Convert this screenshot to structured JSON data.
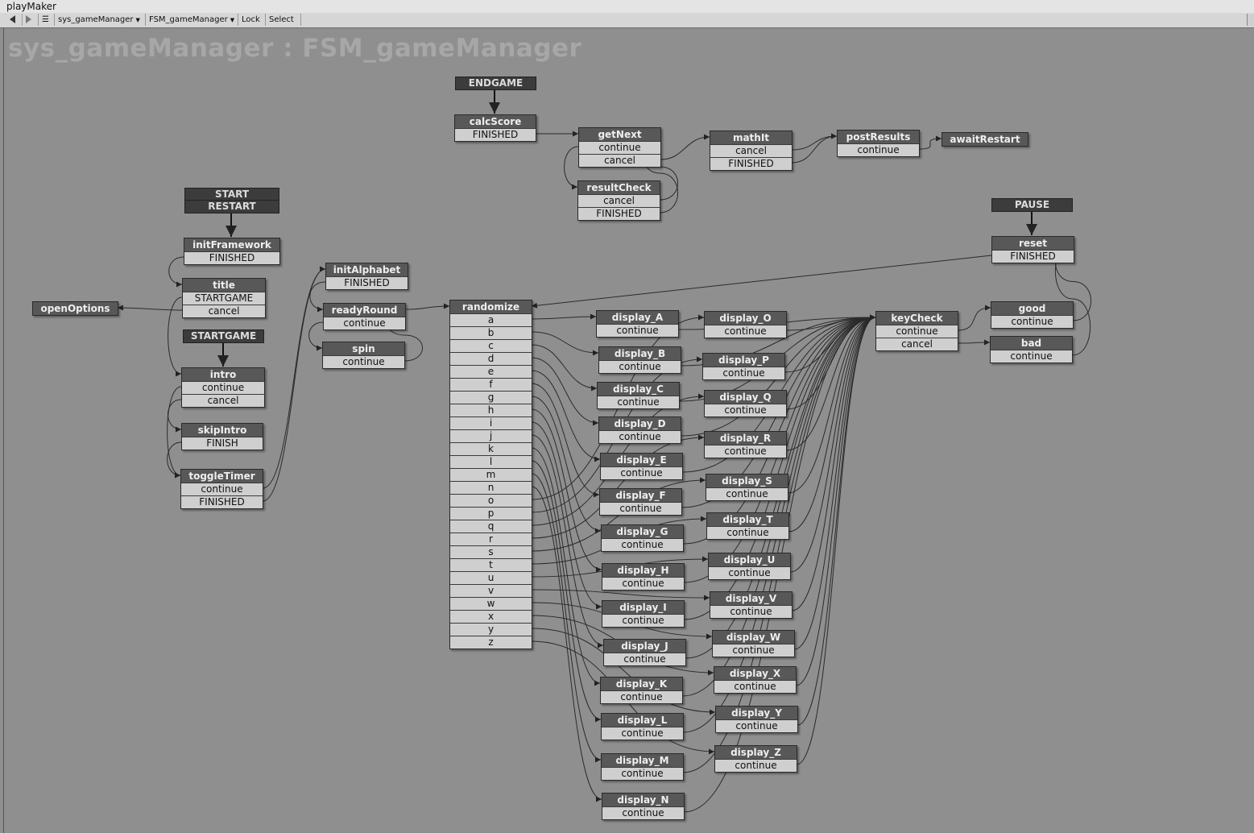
{
  "window": {
    "title": "playMaker"
  },
  "toolbar": {
    "back_icon": "triangle-left",
    "forward_icon": "triangle-right",
    "menu_icon": "hamburger",
    "gameobject": "sys_gameManager",
    "fsm": "FSM_gameManager",
    "lock_label": "Lock",
    "select_label": "Select"
  },
  "graph": {
    "title": "sys_gameManager : FSM_gameManager",
    "global_events": [
      {
        "id": "ev_endgame",
        "lines": [
          "ENDGAME"
        ]
      },
      {
        "id": "ev_start",
        "lines": [
          "START",
          "RESTART"
        ]
      },
      {
        "id": "ev_startgame",
        "lines": [
          "STARTGAME"
        ]
      },
      {
        "id": "ev_pause",
        "lines": [
          "PAUSE"
        ]
      }
    ],
    "states": [
      {
        "id": "calcScore",
        "name": "calcScore",
        "transitions": [
          "FINISHED"
        ]
      },
      {
        "id": "getNext",
        "name": "getNext",
        "transitions": [
          "continue",
          "cancel"
        ]
      },
      {
        "id": "resultCheck",
        "name": "resultCheck",
        "transitions": [
          "cancel",
          "FINISHED"
        ]
      },
      {
        "id": "mathIt",
        "name": "mathIt",
        "transitions": [
          "cancel",
          "FINISHED"
        ]
      },
      {
        "id": "postResults",
        "name": "postResults",
        "transitions": [
          "continue"
        ]
      },
      {
        "id": "awaitRestart",
        "name": "awaitRestart",
        "transitions": []
      },
      {
        "id": "initFramework",
        "name": "initFramework",
        "transitions": [
          "FINISHED"
        ]
      },
      {
        "id": "title",
        "name": "title",
        "transitions": [
          "STARTGAME",
          "cancel"
        ]
      },
      {
        "id": "openOptions",
        "name": "openOptions",
        "transitions": []
      },
      {
        "id": "intro",
        "name": "intro",
        "transitions": [
          "continue",
          "cancel"
        ]
      },
      {
        "id": "skipIntro",
        "name": "skipIntro",
        "transitions": [
          "FINISH"
        ]
      },
      {
        "id": "toggleTimer",
        "name": "toggleTimer",
        "transitions": [
          "continue",
          "FINISHED"
        ]
      },
      {
        "id": "initAlphabet",
        "name": "initAlphabet",
        "transitions": [
          "FINISHED"
        ]
      },
      {
        "id": "readyRound",
        "name": "readyRound",
        "transitions": [
          "continue"
        ]
      },
      {
        "id": "spin",
        "name": "spin",
        "transitions": [
          "continue"
        ]
      },
      {
        "id": "randomize",
        "name": "randomize",
        "transitions": [
          "a",
          "b",
          "c",
          "d",
          "e",
          "f",
          "g",
          "h",
          "i",
          "j",
          "k",
          "l",
          "m",
          "n",
          "o",
          "p",
          "q",
          "r",
          "s",
          "t",
          "u",
          "v",
          "w",
          "x",
          "y",
          "z"
        ]
      },
      {
        "id": "display_A",
        "name": "display_A",
        "transitions": [
          "continue"
        ]
      },
      {
        "id": "display_B",
        "name": "display_B",
        "transitions": [
          "continue"
        ]
      },
      {
        "id": "display_C",
        "name": "display_C",
        "transitions": [
          "continue"
        ]
      },
      {
        "id": "display_D",
        "name": "display_D",
        "transitions": [
          "continue"
        ]
      },
      {
        "id": "display_E",
        "name": "display_E",
        "transitions": [
          "continue"
        ]
      },
      {
        "id": "display_F",
        "name": "display_F",
        "transitions": [
          "continue"
        ]
      },
      {
        "id": "display_G",
        "name": "display_G",
        "transitions": [
          "continue"
        ]
      },
      {
        "id": "display_H",
        "name": "display_H",
        "transitions": [
          "continue"
        ]
      },
      {
        "id": "display_I",
        "name": "display_I",
        "transitions": [
          "continue"
        ]
      },
      {
        "id": "display_J",
        "name": "display_J",
        "transitions": [
          "continue"
        ]
      },
      {
        "id": "display_K",
        "name": "display_K",
        "transitions": [
          "continue"
        ]
      },
      {
        "id": "display_L",
        "name": "display_L",
        "transitions": [
          "continue"
        ]
      },
      {
        "id": "display_M",
        "name": "display_M",
        "transitions": [
          "continue"
        ]
      },
      {
        "id": "display_N",
        "name": "display_N",
        "transitions": [
          "continue"
        ]
      },
      {
        "id": "display_O",
        "name": "display_O",
        "transitions": [
          "continue"
        ]
      },
      {
        "id": "display_P",
        "name": "display_P",
        "transitions": [
          "continue"
        ]
      },
      {
        "id": "display_Q",
        "name": "display_Q",
        "transitions": [
          "continue"
        ]
      },
      {
        "id": "display_R",
        "name": "display_R",
        "transitions": [
          "continue"
        ]
      },
      {
        "id": "display_S",
        "name": "display_S",
        "transitions": [
          "continue"
        ]
      },
      {
        "id": "display_T",
        "name": "display_T",
        "transitions": [
          "continue"
        ]
      },
      {
        "id": "display_U",
        "name": "display_U",
        "transitions": [
          "continue"
        ]
      },
      {
        "id": "display_V",
        "name": "display_V",
        "transitions": [
          "continue"
        ]
      },
      {
        "id": "display_W",
        "name": "display_W",
        "transitions": [
          "continue"
        ]
      },
      {
        "id": "display_X",
        "name": "display_X",
        "transitions": [
          "continue"
        ]
      },
      {
        "id": "display_Y",
        "name": "display_Y",
        "transitions": [
          "continue"
        ]
      },
      {
        "id": "display_Z",
        "name": "display_Z",
        "transitions": [
          "continue"
        ]
      },
      {
        "id": "keyCheck",
        "name": "keyCheck",
        "transitions": [
          "continue",
          "cancel"
        ]
      },
      {
        "id": "reset",
        "name": "reset",
        "transitions": [
          "FINISHED"
        ]
      },
      {
        "id": "good",
        "name": "good",
        "transitions": [
          "continue"
        ]
      },
      {
        "id": "bad",
        "name": "bad",
        "transitions": [
          "continue"
        ]
      }
    ]
  }
}
